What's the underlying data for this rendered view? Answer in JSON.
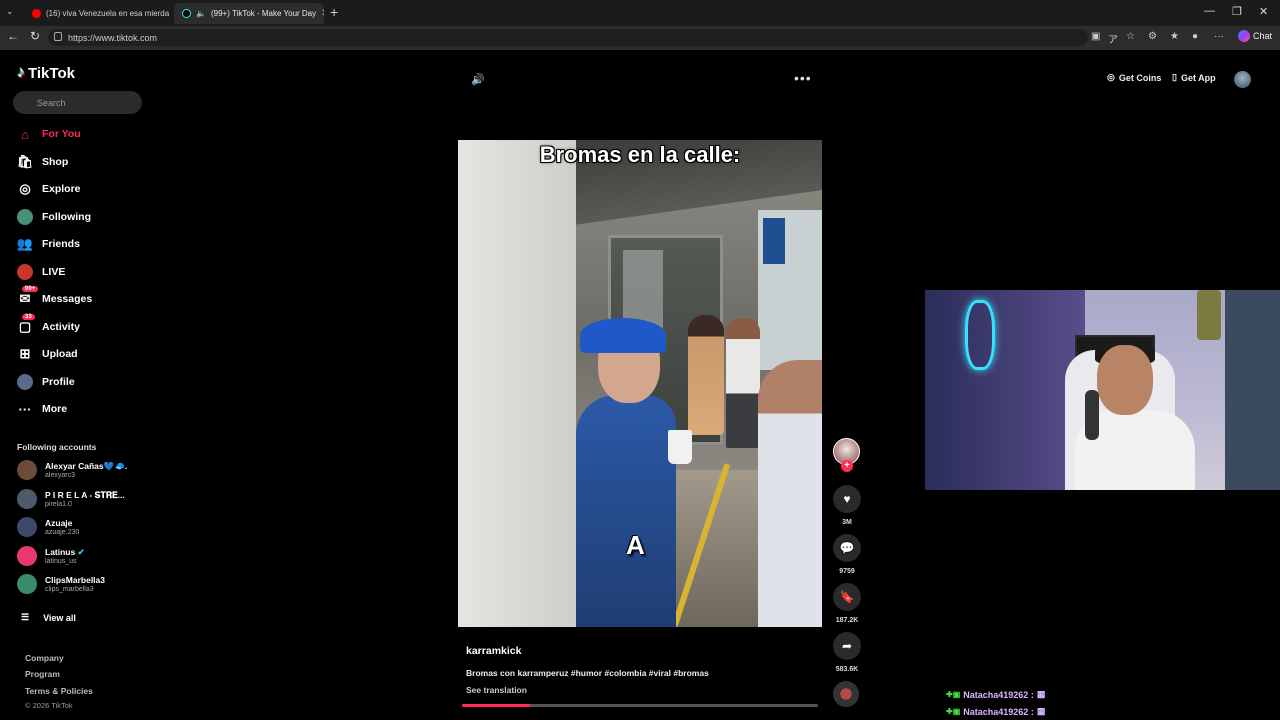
{
  "browser": {
    "tabs": [
      {
        "title": "(16) viva Venezuela en esa mierda",
        "active": false
      },
      {
        "title": "(99+) TikTok - Make Your Day",
        "active": true
      }
    ],
    "url": "https://www.tiktok.com",
    "chat_label": "Chat"
  },
  "sidebar": {
    "brand": "TikTok",
    "search_placeholder": "Search",
    "nav": [
      {
        "label": "For You",
        "icon": "home-icon",
        "active": true
      },
      {
        "label": "Shop",
        "icon": "shop-icon"
      },
      {
        "label": "Explore",
        "icon": "compass-icon"
      },
      {
        "label": "Following",
        "icon": "following-avatar-icon"
      },
      {
        "label": "Friends",
        "icon": "friends-icon"
      },
      {
        "label": "LIVE",
        "icon": "live-icon"
      },
      {
        "label": "Messages",
        "icon": "messages-icon",
        "badge": "99+"
      },
      {
        "label": "Activity",
        "icon": "activity-icon",
        "badge": "33"
      },
      {
        "label": "Upload",
        "icon": "upload-icon"
      },
      {
        "label": "Profile",
        "icon": "profile-avatar-icon"
      },
      {
        "label": "More",
        "icon": "more-icon"
      }
    ],
    "following_title": "Following accounts",
    "following": [
      {
        "name": "Alexyar Cañas💙🧢.",
        "user": "alexyarc3",
        "color": "#6b4c3b"
      },
      {
        "name": "P I R E L A - 𝐒𝐓𝐑𝐄...",
        "user": "pirela1.0",
        "color": "#4c5a6b"
      },
      {
        "name": "Azuaje",
        "user": "azuaje.230",
        "color": "#3b4a6b"
      },
      {
        "name": "Latinus",
        "user": "latinus_us",
        "color": "#e83a6a",
        "verified": true
      },
      {
        "name": "ClipsMarbella3",
        "user": "clips_marbella3",
        "color": "#3b8c6b"
      }
    ],
    "view_all": "View all",
    "footer": [
      "Company",
      "Program",
      "Terms & Policies"
    ],
    "copyright": "© 2026 TikTok"
  },
  "header": {
    "get_coins": "Get Coins",
    "get_app": "Get App"
  },
  "video": {
    "caption_overlay": "Bromas en la calle:",
    "subtitle_letter": "A",
    "author": "karramkick",
    "description": "Bromas con karramperuz #humor #colombia #viral #bromas",
    "see_translation": "See translation",
    "progress": 0.19
  },
  "actions": {
    "likes": "3M",
    "comments": "9759",
    "saves": "187.2K",
    "shares": "583.6K"
  },
  "stream_chat": [
    {
      "user": "Natacha419262 :"
    },
    {
      "user": "Natacha419262 :"
    }
  ]
}
